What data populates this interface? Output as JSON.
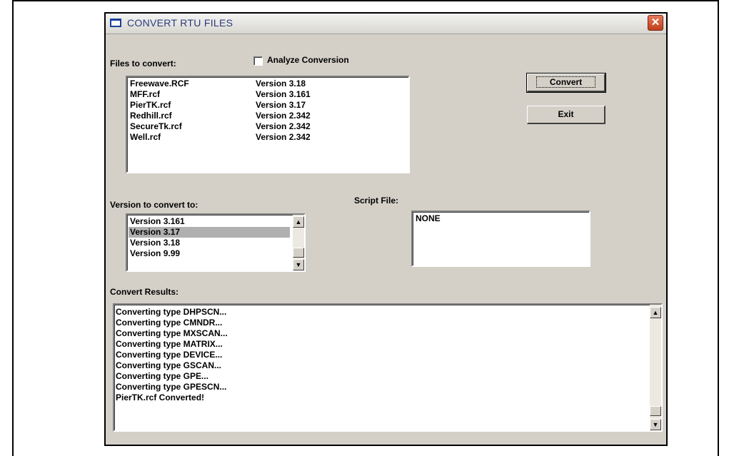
{
  "window": {
    "title": "CONVERT RTU FILES",
    "close_label": "✕"
  },
  "files": {
    "label": "Files to convert:",
    "items": [
      {
        "name": "Freewave.RCF",
        "version": "Version 3.18"
      },
      {
        "name": "MFF.rcf",
        "version": "Version 3.161"
      },
      {
        "name": "PierTK.rcf",
        "version": "Version 3.17"
      },
      {
        "name": "Redhill.rcf",
        "version": "Version 2.342"
      },
      {
        "name": "SecureTk.rcf",
        "version": "Version 2.342"
      },
      {
        "name": "Well.rcf",
        "version": "Version 2.342"
      }
    ]
  },
  "analyze": {
    "label": "Analyze Conversion",
    "checked": false
  },
  "buttons": {
    "convert": "Convert",
    "exit": "Exit"
  },
  "version_to": {
    "label": "Version to convert to:",
    "items": [
      "Version 3.161",
      "Version 3.17",
      "Version 3.18",
      "Version 9.99"
    ],
    "selected": "Version 3.17"
  },
  "script": {
    "label": "Script File:",
    "value": "NONE"
  },
  "results": {
    "label": "Convert Results:",
    "lines": [
      "Converting type DHPSCN...",
      "Converting type CMNDR...",
      "Converting type MXSCAN...",
      "Converting type MATRIX...",
      "Converting type DEVICE...",
      "Converting type GSCAN...",
      "Converting type GPE...",
      "Converting type GPESCN...",
      "PierTK.rcf Converted!"
    ]
  },
  "icons": {
    "scroll_up": "▲",
    "scroll_down": "▼"
  }
}
